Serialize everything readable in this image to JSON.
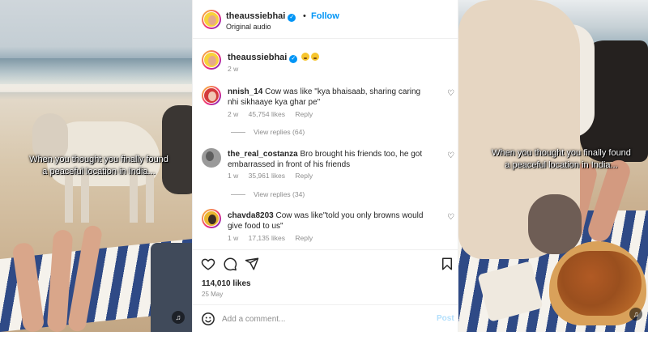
{
  "left_video": {
    "caption_line1": "When you thought you finally found",
    "caption_line2": "a peaceful location in India..."
  },
  "right_video": {
    "caption_line1": "When you thought you finally found",
    "caption_line2": "a peaceful location in India..."
  },
  "post": {
    "header": {
      "username": "theaussiebhai",
      "separator": "•",
      "follow_label": "Follow",
      "audio": "Original audio"
    },
    "caption": {
      "username": "theaussiebhai",
      "time": "2 w"
    },
    "comments": [
      {
        "username": "nnish_14",
        "text": "Cow was like \"kya bhaisaab, sharing caring nhi sikhaaye kya ghar pe\"",
        "time": "2 w",
        "likes": "45,754 likes",
        "reply": "Reply",
        "view_replies": "View replies (64)"
      },
      {
        "username": "the_real_costanza",
        "text": "Bro brought his friends too, he got embarrassed in front of his friends",
        "time": "1 w",
        "likes": "35,961 likes",
        "reply": "Reply",
        "view_replies": "View replies (34)"
      },
      {
        "username": "chavda8203",
        "text": "Cow was like\"told you only browns would give food to us\"",
        "time": "1 w",
        "likes": "17,135 likes",
        "reply": "Reply"
      }
    ],
    "likes_count": "114,010 likes",
    "date": "25 May",
    "add_comment_placeholder": "Add a comment...",
    "post_label": "Post"
  },
  "icons": {
    "verified": "verified-badge-icon",
    "heart": "heart-outline-icon",
    "comment": "comment-icon",
    "share": "paper-plane-icon",
    "save": "bookmark-icon",
    "smiley": "emoji-smiley-icon",
    "volume": "speaker-icon"
  },
  "colors": {
    "accent": "#0095f6",
    "muted": "#8e8e8e",
    "text": "#262626"
  }
}
